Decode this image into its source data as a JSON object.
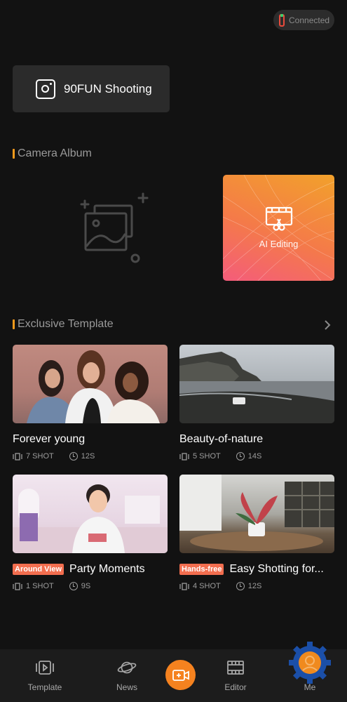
{
  "status": {
    "connection": "Connected"
  },
  "shooting": {
    "label": "90FUN Shooting"
  },
  "album": {
    "title": "Camera Album"
  },
  "ai_editing": {
    "label": "AI Editing"
  },
  "templates": {
    "title": "Exclusive Template",
    "items": [
      {
        "title": "Forever young",
        "badge": "",
        "shots": "7 SHOT",
        "duration": "12S"
      },
      {
        "title": "Beauty-of-nature",
        "badge": "",
        "shots": "5 SHOT",
        "duration": "14S"
      },
      {
        "title": "Party Moments",
        "badge": "Around View",
        "shots": "1 SHOT",
        "duration": "9S"
      },
      {
        "title": "Easy Shotting for...",
        "badge": "Hands-free",
        "shots": "4 SHOT",
        "duration": "12S"
      }
    ]
  },
  "tabbar": {
    "template": "Template",
    "news": "News",
    "editor": "Editor",
    "me": "Me"
  },
  "colors": {
    "accent": "#f5821f",
    "badge": "#f26e4f",
    "background": "#121212"
  }
}
